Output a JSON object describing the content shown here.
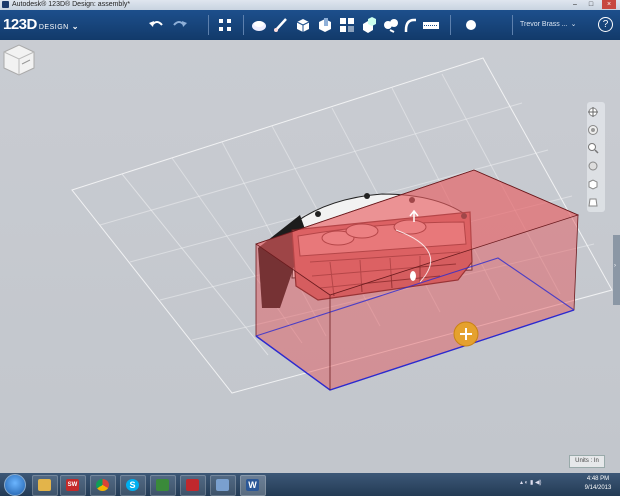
{
  "window": {
    "title": "Autodesk® 123D® Design: assembly*",
    "min_glyph": "–",
    "max_glyph": "□",
    "close_glyph": "×"
  },
  "toolbar": {
    "logo_main": "123D",
    "logo_sub": "DESIGN",
    "logo_chevron": "⌄",
    "tools": [
      "undo-icon",
      "redo-icon",
      "transform-icon",
      "primitives-icon",
      "sketch-icon",
      "construct-icon",
      "modify-icon",
      "pattern-icon",
      "grouping-icon",
      "snap-icon",
      "measure-icon",
      "text-icon",
      "material-icon"
    ],
    "user_name": "Trevor Brass ...",
    "user_chevron": "⌄",
    "help_label": "?"
  },
  "colors": {
    "toolbar_bg": "#1d4f8c",
    "selection_fill": "#e44d52",
    "selection_edge": "#2c2ad0",
    "viewport_bg": "#c6cad0",
    "grid": "#ffffff",
    "handle": "#e5a12e"
  },
  "viewport": {
    "units_label": "Units : In",
    "side_handle": "›"
  },
  "navbar": {
    "buttons": [
      "pan-icon",
      "orbit-icon",
      "zoom-icon",
      "fit-icon",
      "view-style-icon",
      "material-view-icon"
    ]
  },
  "taskbar": {
    "apps": [
      "explorer-icon",
      "solidworks-icon",
      "chrome-icon",
      "skype-icon",
      "app-icon",
      "acrobat-icon",
      "files-icon",
      "word-icon"
    ],
    "app_glyphs": [
      "",
      "SW",
      "",
      "S",
      "",
      "",
      "",
      "W"
    ],
    "time": "4:48 PM",
    "date": "9/14/2013"
  }
}
